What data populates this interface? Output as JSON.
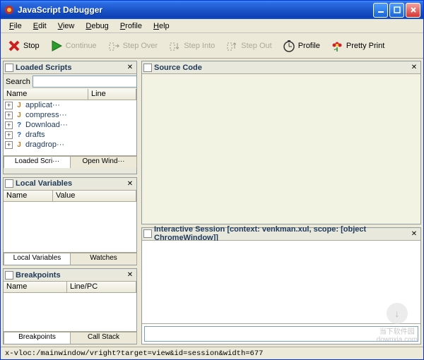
{
  "window": {
    "title": "JavaScript Debugger"
  },
  "menus": {
    "file": "File",
    "edit": "Edit",
    "view": "View",
    "debug": "Debug",
    "profile": "Profile",
    "help": "Help"
  },
  "toolbar": {
    "stop": "Stop",
    "continue": "Continue",
    "stepOver": "Step Over",
    "stepInto": "Step Into",
    "stepOut": "Step Out",
    "profile": "Profile",
    "prettyPrint": "Pretty Print"
  },
  "panels": {
    "loadedScripts": {
      "title": "Loaded Scripts",
      "searchLabel": "Search",
      "searchValue": "",
      "cols": {
        "name": "Name",
        "line": "Line"
      },
      "tabs": {
        "loaded": "Loaded Scri···",
        "openWind": "Open Wind···"
      },
      "items": [
        {
          "icon": "j",
          "name": "applicat···"
        },
        {
          "icon": "j",
          "name": "compress···"
        },
        {
          "icon": "q",
          "name": "Download···"
        },
        {
          "icon": "q",
          "name": "drafts"
        },
        {
          "icon": "j",
          "name": "dragdrop···"
        }
      ]
    },
    "localVars": {
      "title": "Local Variables",
      "cols": {
        "name": "Name",
        "value": "Value"
      },
      "tabs": {
        "local": "Local Variables",
        "watches": "Watches"
      }
    },
    "breakpoints": {
      "title": "Breakpoints",
      "cols": {
        "name": "Name",
        "linepc": "Line/PC"
      },
      "tabs": {
        "bps": "Breakpoints",
        "callstack": "Call Stack"
      }
    },
    "sourceCode": {
      "title": "Source Code"
    },
    "interactive": {
      "title": "Interactive Session [context: venkman.xul, scope: [object ChromeWindow]]",
      "inputValue": ""
    }
  },
  "statusbar": "x-vloc:/mainwindow/vright?target=view&id=session&width=677",
  "watermark": {
    "line1": "当下软件园",
    "line2": "downxia.com"
  }
}
